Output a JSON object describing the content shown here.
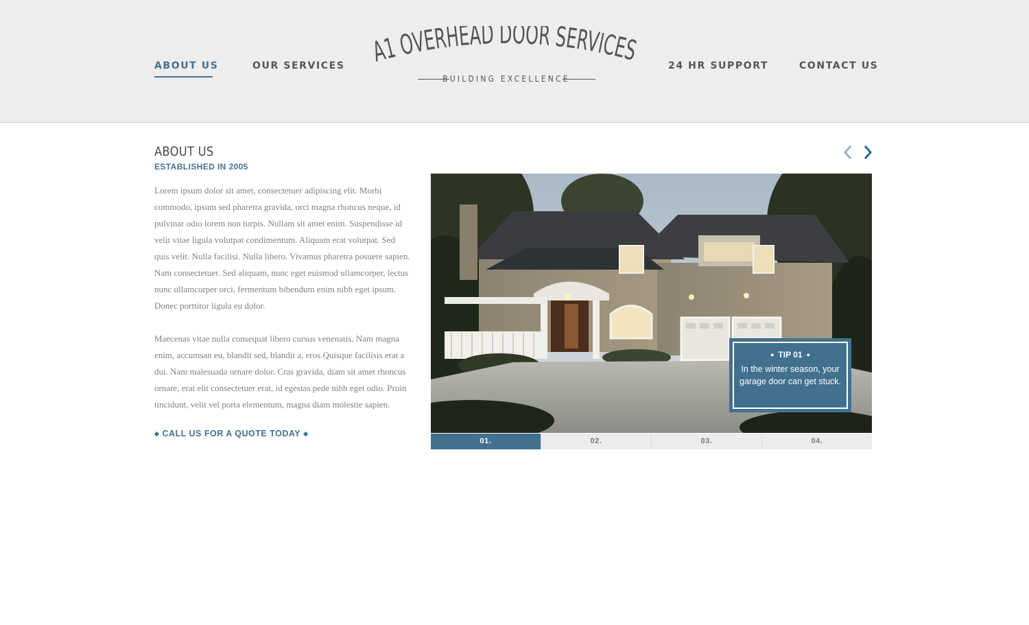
{
  "nav": {
    "items": [
      {
        "label": "ABOUT US",
        "active": true
      },
      {
        "label": "OUR SERVICES",
        "active": false
      },
      {
        "label": "24 HR SUPPORT",
        "active": false
      },
      {
        "label": "CONTACT US",
        "active": false
      }
    ]
  },
  "logo": {
    "title": "A1 OVERHEAD DOOR SERVICES",
    "tagline": "BUILDING EXCELLENCE"
  },
  "about": {
    "title": "ABOUT US",
    "subtitle": "ESTABLISHED IN 2005",
    "paragraphs": [
      "Lorem ipsum dolor sit amet, consectetuer adipiscing elit. Morbi commodo, ipsum sed pharetra gravida, orci magna rhoncus neque, id pulvinar odio lorem non turpis. Nullam sit amet enim. Suspendisse id velit vitae ligula volutpat condimentum. Aliquam erat volutpat. Sed quis velit. Nulla facilisi. Nulla libero. Vivamus pharetra posuere sapien. Nam consectetuer. Sed aliquam, nunc eget euismod ullamcorper, lectus nunc ullamcorper orci, fermentum bibendum enim nibh eget ipsum. Donec porttitor ligula eu dolor.",
      "Maecenas vitae nulla consequat libero cursus venenatis. Nam magna enim, accumsan eu, blandit sed, blandit a, eros.Quisque facilisis erat a dui. Nam malesuada ornare dolor. Cras gravida, diam sit amet rhoncus ornare, erat elit consectetuer erat, id egestas pede nibh eget odio. Proin tincidunt, velit vel porta elementum, magna diam molestie sapien."
    ],
    "cta": "CALL US FOR A QUOTE TODAY"
  },
  "slider": {
    "tip_title": "TIP 01",
    "tip_text": "In the winter season, your garage door can get stuck.",
    "pages": [
      "01.",
      "02.",
      "03.",
      "04."
    ],
    "active_page": 0
  },
  "colors": {
    "accent": "#42708f",
    "header_bg": "#ededed",
    "text_gray": "#808080"
  },
  "icons": {
    "prev": "chevron-left-icon",
    "next": "chevron-right-icon"
  }
}
